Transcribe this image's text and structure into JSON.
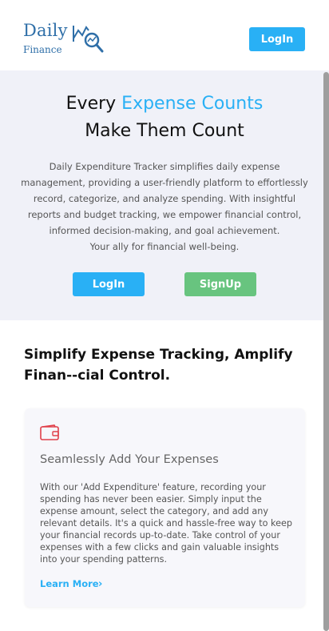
{
  "header": {
    "logo_word": "Daily",
    "logo_sub": "Finance",
    "login_label": "LogIn"
  },
  "hero": {
    "title_prefix": "Every ",
    "title_accent": "Expense Counts",
    "title_line2": "Make Them Count",
    "description": "Daily Expenditure Tracker simplifies daily expense management, providing a user-friendly platform to effortlessly record, categorize, and analyze spending. With insightful reports and budget tracking, we empower financial control, informed decision-making, and goal achievement.",
    "tagline": "Your ally for financial well-being.",
    "login_label": "LogIn",
    "signup_label": "SignUp"
  },
  "features": {
    "title": "Simplify Expense Tracking, Amplify Finan--cial Control.",
    "card": {
      "icon": "wallet-icon",
      "title": "Seamlessly Add Your Expenses",
      "text": "With our 'Add Expenditure' feature, recording your spending has never been easier. Simply input the expense amount, select the category, and add any relevant details. It's a quick and hassle-free way to keep your financial records up-to-date. Take control of your expenses with a few clicks and gain valuable insights into your spending patterns.",
      "link_label": "Learn More",
      "link_icon": "chevron-right-icon"
    }
  },
  "colors": {
    "accent": "#29b0f5",
    "signup": "#68c47f",
    "hero_bg": "#f0f1f8",
    "logo": "#2f6fa8",
    "wallet_icon": "#e0404a"
  }
}
